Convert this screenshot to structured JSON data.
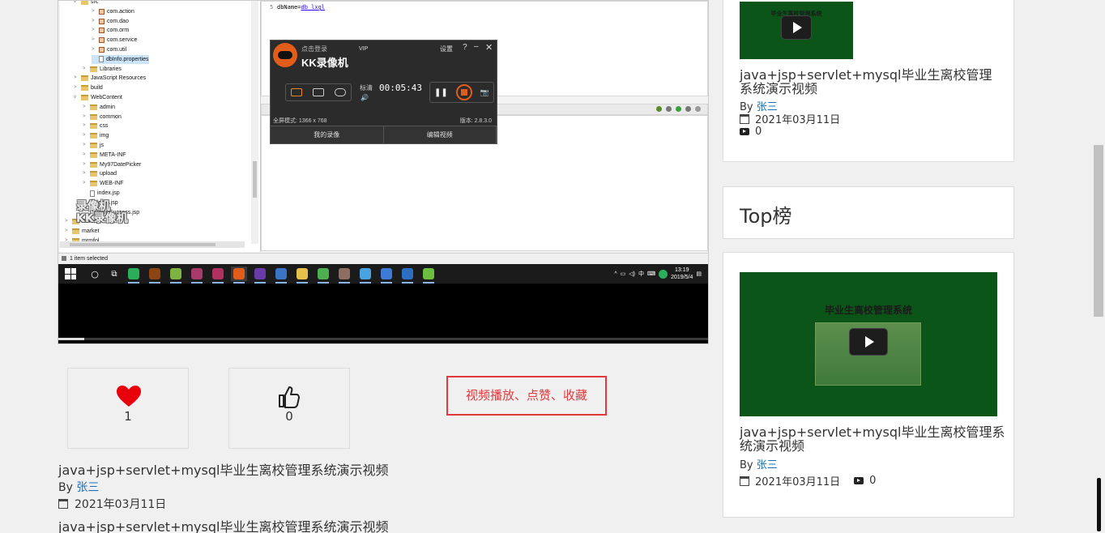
{
  "video": {
    "tree": [
      {
        "label": "src",
        "indent": 1,
        "kind": "folder",
        "twisty": "v"
      },
      {
        "label": "com.action",
        "indent": 3,
        "kind": "pkg",
        "twisty": ">"
      },
      {
        "label": "com.dao",
        "indent": 3,
        "kind": "pkg",
        "twisty": ">"
      },
      {
        "label": "com.orm",
        "indent": 3,
        "kind": "pkg",
        "twisty": ">"
      },
      {
        "label": "com.service",
        "indent": 3,
        "kind": "pkg",
        "twisty": ">"
      },
      {
        "label": "com.util",
        "indent": 3,
        "kind": "pkg",
        "twisty": ">"
      },
      {
        "label": "dbInfo.properties",
        "indent": 3,
        "kind": "file",
        "twisty": "",
        "selected": true
      },
      {
        "label": "Libraries",
        "indent": 2,
        "kind": "folder",
        "twisty": ">"
      },
      {
        "label": "JavaScript Resources",
        "indent": 1,
        "kind": "folder",
        "twisty": ">"
      },
      {
        "label": "build",
        "indent": 1,
        "kind": "folder",
        "twisty": ">"
      },
      {
        "label": "WebContent",
        "indent": 1,
        "kind": "folder",
        "twisty": "v"
      },
      {
        "label": "admin",
        "indent": 2,
        "kind": "folder",
        "twisty": ">"
      },
      {
        "label": "common",
        "indent": 2,
        "kind": "folder",
        "twisty": ">"
      },
      {
        "label": "css",
        "indent": 2,
        "kind": "folder",
        "twisty": ">"
      },
      {
        "label": "img",
        "indent": 2,
        "kind": "folder",
        "twisty": ">"
      },
      {
        "label": "js",
        "indent": 2,
        "kind": "folder",
        "twisty": ">"
      },
      {
        "label": "META-INF",
        "indent": 2,
        "kind": "folder",
        "twisty": ">"
      },
      {
        "label": "My97DatePicker",
        "indent": 2,
        "kind": "folder",
        "twisty": ">"
      },
      {
        "label": "upload",
        "indent": 2,
        "kind": "folder",
        "twisty": ">"
      },
      {
        "label": "WEB-INF",
        "indent": 2,
        "kind": "folder",
        "twisty": ">"
      },
      {
        "label": "index.jsp",
        "indent": 2,
        "kind": "file",
        "twisty": ""
      },
      {
        "label": "login.jsp",
        "indent": 2,
        "kind": "file",
        "twisty": ""
      },
      {
        "label": "loginSuccess.jsp",
        "indent": 2,
        "kind": "file",
        "twisty": ""
      },
      {
        "label": "Servers",
        "indent": 0,
        "kind": "folder",
        "twisty": ">"
      },
      {
        "label": "market",
        "indent": 0,
        "kind": "folder",
        "twisty": ">"
      },
      {
        "label": "mrmfol",
        "indent": 0,
        "kind": "folder",
        "twisty": ">"
      }
    ],
    "editor_line_no": "5",
    "editor_key": "dbName=",
    "editor_value": "db_lxgl",
    "status_text": "1 item selected",
    "kk": {
      "login": "点击登录",
      "title": "KK录像机",
      "vip": "VIP",
      "settings": "设置",
      "help": "?",
      "minimize": "–",
      "close": "✕",
      "quality": "标清",
      "volume": "🔊",
      "time": "00:05:43",
      "pause": "❚❚",
      "camera": "📷",
      "mode_text": "全屏模式: 1366 x 768",
      "version": "版本: 2.8.3.0",
      "my_videos": "我的录像",
      "edit_video": "编辑视频",
      "watermark_line1": "录像机",
      "watermark_line2": "KK录像机"
    },
    "taskbar_clock_time": "13:19",
    "taskbar_clock_date": "2019/5/4",
    "taskbar_ime": "中",
    "taskbar_colors": [
      "#2aae5a",
      "#8b4513",
      "#7cb342",
      "#a63a6b",
      "#b03060",
      "#e35d1a",
      "#6a3aa8",
      "#3b73c5",
      "#e7c04a",
      "#4caf50",
      "#8d6e63",
      "#4aa3df",
      "#3e7bd6",
      "#2c6fc2",
      "#6cbf3e"
    ],
    "active_app_index": 5,
    "progress": 0.04
  },
  "actions": {
    "like_count": "1",
    "thumb_count": "0",
    "annotation": "视频播放、点赞、收藏"
  },
  "main_info": {
    "title": "java+jsp+servlet+mysql毕业生离校管理系统演示视频",
    "by_prefix": "By ",
    "author": "张三",
    "date": "2021年03月11日",
    "title_repeat": "java+jsp+servlet+mysql毕业生离校管理系统演示视频"
  },
  "sidebar": {
    "card1": {
      "thumb_heading": "毕业生离校管理系统",
      "title_line1": "java+jsp+servlet+mysql毕业生离校管理",
      "title_line2": "系统演示视频",
      "by_prefix": "By ",
      "author": "张三",
      "date": "2021年03月11日",
      "views": "0"
    },
    "top_title": "Top榜",
    "card2": {
      "thumb_heading": "毕业生离校管理系统",
      "title_line1": "java+jsp+servlet+mysql毕业生离校管理系",
      "title_line2": "统演示视频",
      "by_prefix": "By ",
      "author": "张三",
      "date": "2021年03月11日",
      "views": "0"
    }
  }
}
